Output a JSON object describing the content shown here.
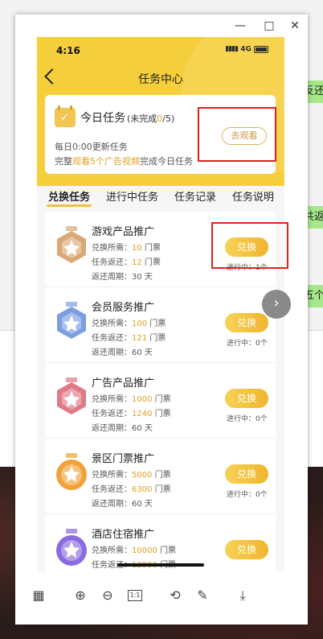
{
  "background": {
    "side_tags": [
      "反还",
      "共返",
      "五个"
    ]
  },
  "window_controls": [
    "×",
    "—",
    "□",
    "✕"
  ],
  "status_bar": {
    "time": "4:16",
    "network": "4G"
  },
  "nav": {
    "title": "任务中心"
  },
  "today_task": {
    "title": "今日任务",
    "sub_prefix": "(未完成",
    "done_count": "0",
    "sub_suffix": "/5)",
    "refresh_text": "每日0:00更新任务",
    "complete_prefix": "完整",
    "complete_highlight": "观看5个广告视频",
    "complete_suffix": "完成今日任务",
    "watch_button": "去观看"
  },
  "tabs": [
    "兑换任务",
    "进行中任务",
    "任务记录",
    "任务说明"
  ],
  "labels": {
    "cost": "兑换所需：",
    "refund": "任务返还：",
    "period": "返还周期：",
    "ticket_unit": " 门票",
    "day_unit": " 天",
    "exchange_button": "兑换",
    "in_progress": "进行中："
  },
  "items": [
    {
      "name": "游戏产品推广",
      "cost": "10",
      "refund": "12",
      "period": "30",
      "progress": "1个",
      "badge_color": "#d9a874"
    },
    {
      "name": "会员服务推广",
      "cost": "100",
      "refund": "121",
      "period": "60",
      "progress": "0个",
      "badge_color": "#7a9ee0"
    },
    {
      "name": "广告产品推广",
      "cost": "1000",
      "refund": "1240",
      "period": "60",
      "progress": "0个",
      "badge_color": "#e07a86"
    },
    {
      "name": "景区门票推广",
      "cost": "5000",
      "refund": "6300",
      "period": "60",
      "progress": "0个",
      "badge_color": "#f0a23a"
    },
    {
      "name": "酒店住宿推广",
      "cost": "10000",
      "refund": "12900",
      "period": "",
      "progress": "",
      "badge_color": "#8a6ae0"
    }
  ],
  "toolbar": [
    "grid-icon",
    "zoom-in-icon",
    "zoom-out-icon",
    "actual-size-icon",
    "rotate-icon",
    "edit-icon",
    "download-icon"
  ],
  "toolbar_glyphs": {
    "actual_size": "1:1"
  }
}
